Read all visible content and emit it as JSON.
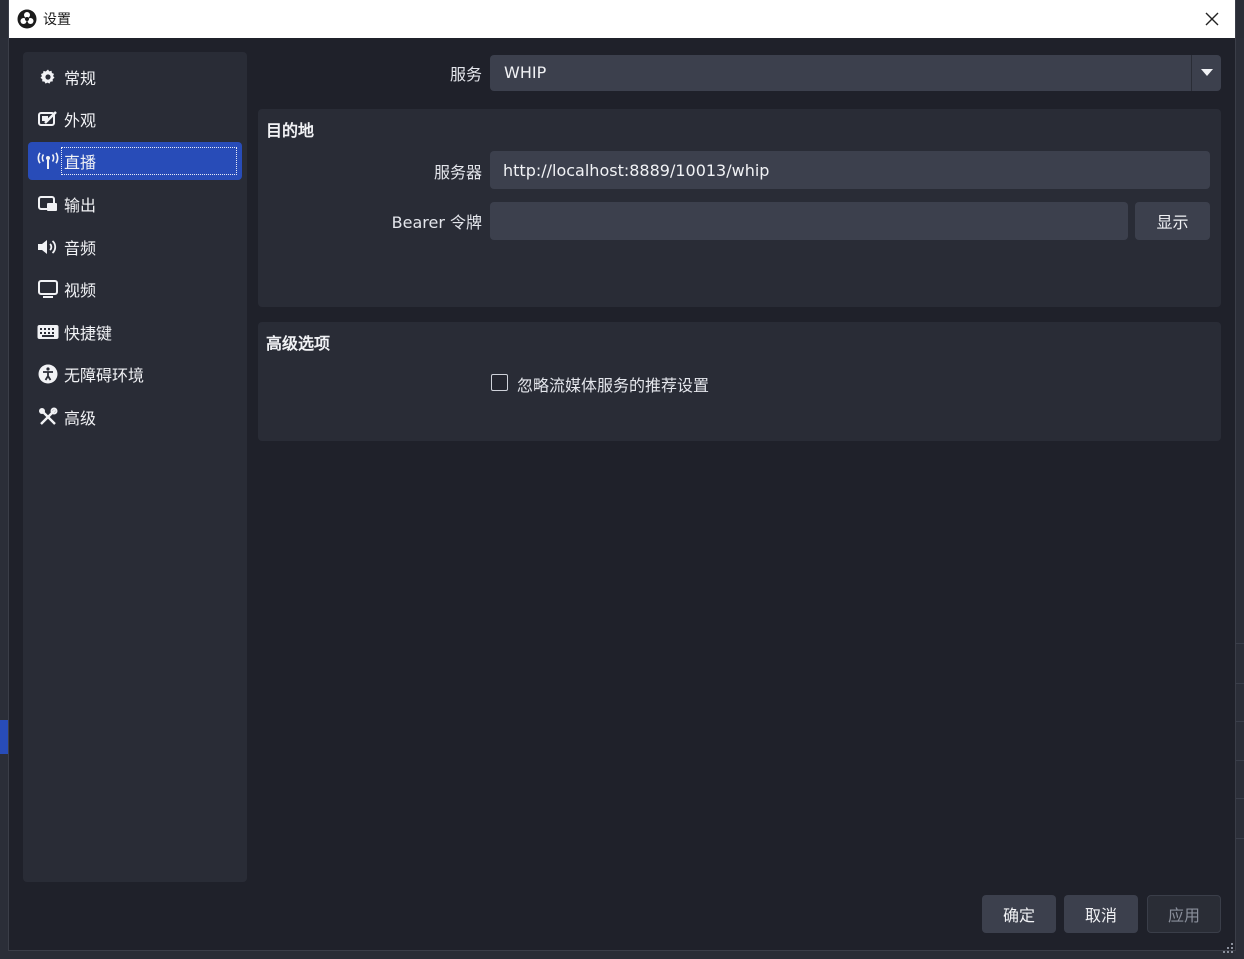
{
  "window": {
    "title": "设置"
  },
  "sidebar": {
    "items": [
      {
        "label": "常规",
        "icon": "gear-icon"
      },
      {
        "label": "外观",
        "icon": "appearance-icon"
      },
      {
        "label": "直播",
        "icon": "antenna-icon",
        "active": true
      },
      {
        "label": "输出",
        "icon": "output-icon"
      },
      {
        "label": "音频",
        "icon": "speaker-icon"
      },
      {
        "label": "视频",
        "icon": "monitor-icon"
      },
      {
        "label": "快捷键",
        "icon": "keyboard-icon"
      },
      {
        "label": "无障碍环境",
        "icon": "accessibility-icon"
      },
      {
        "label": "高级",
        "icon": "tools-icon"
      }
    ]
  },
  "stream": {
    "service_label": "服务",
    "service_value": "WHIP",
    "destination": {
      "title": "目的地",
      "server_label": "服务器",
      "server_value": "http://localhost:8889/10013/whip",
      "token_label": "Bearer 令牌",
      "token_value": "",
      "show_button": "显示"
    },
    "advanced": {
      "title": "高级选项",
      "ignore_label": "忽略流媒体服务的推荐设置",
      "ignore_checked": false
    }
  },
  "footer": {
    "ok_label": "确定",
    "cancel_label": "取消",
    "apply_label": "应用"
  },
  "colors": {
    "accent": "#284cb8",
    "background": "#1f212a",
    "panel": "#292c36",
    "input": "#3c404d"
  }
}
